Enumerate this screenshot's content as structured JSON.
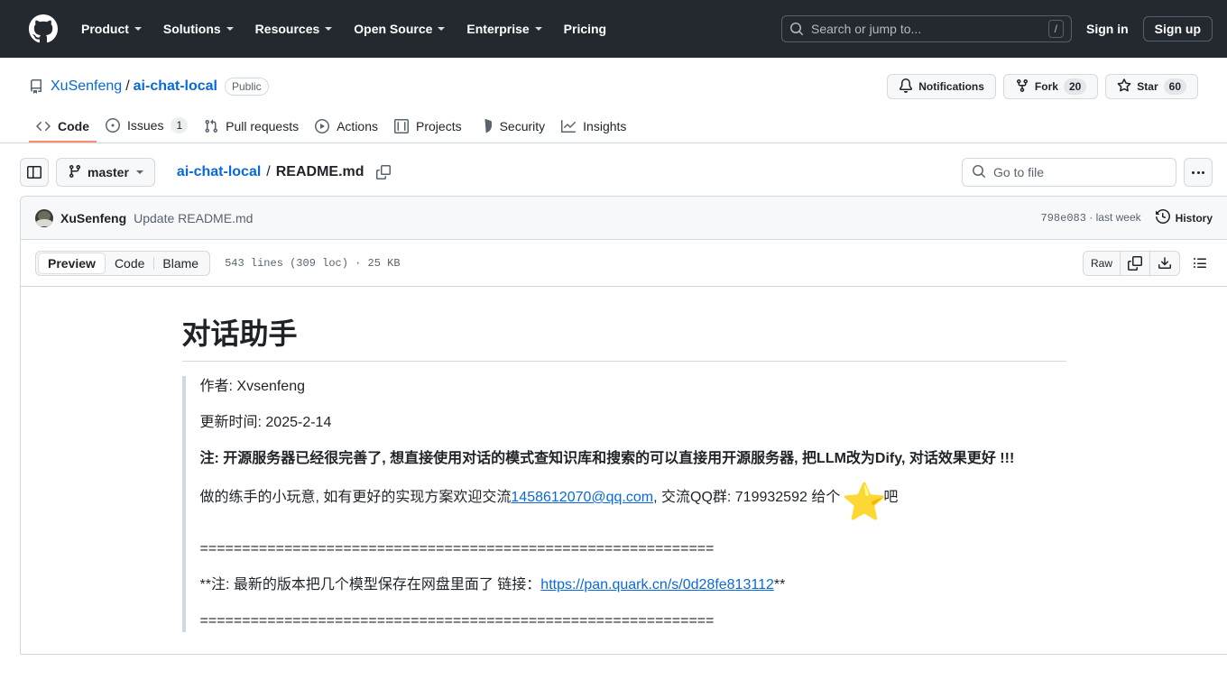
{
  "header": {
    "logo_icon": "github-mark-icon",
    "nav": [
      {
        "label": "Product",
        "has_caret": true
      },
      {
        "label": "Solutions",
        "has_caret": true
      },
      {
        "label": "Resources",
        "has_caret": true
      },
      {
        "label": "Open Source",
        "has_caret": true
      },
      {
        "label": "Enterprise",
        "has_caret": true
      },
      {
        "label": "Pricing",
        "has_caret": false
      }
    ],
    "search": {
      "placeholder": "Search or jump to...",
      "shortcut": "/",
      "icon": "search-icon"
    },
    "sign_in": "Sign in",
    "sign_up": "Sign up"
  },
  "repo": {
    "icon": "repo-book-icon",
    "owner": "XuSenfeng",
    "separator": "/",
    "name": "ai-chat-local",
    "visibility": "Public",
    "actions": {
      "notifications": {
        "label": "Notifications",
        "icon": "bell-icon"
      },
      "fork": {
        "label": "Fork",
        "count": "20",
        "icon": "fork-icon"
      },
      "star": {
        "label": "Star",
        "count": "60",
        "icon": "star-icon"
      }
    },
    "tabs": [
      {
        "label": "Code",
        "icon": "code-icon",
        "active": true,
        "count": ""
      },
      {
        "label": "Issues",
        "icon": "issue-opened-icon",
        "active": false,
        "count": "1"
      },
      {
        "label": "Pull requests",
        "icon": "git-pull-request-icon",
        "active": false,
        "count": ""
      },
      {
        "label": "Actions",
        "icon": "play-icon",
        "active": false,
        "count": ""
      },
      {
        "label": "Projects",
        "icon": "table-icon",
        "active": false,
        "count": ""
      },
      {
        "label": "Security",
        "icon": "shield-icon",
        "active": false,
        "count": ""
      },
      {
        "label": "Insights",
        "icon": "graph-icon",
        "active": false,
        "count": ""
      }
    ]
  },
  "file_nav": {
    "sidebar_toggle_icon": "sidebar-expand-icon",
    "branch": "master",
    "branch_icon": "git-branch-icon",
    "breadcrumb_repo": "ai-chat-local",
    "breadcrumb_sep": "/",
    "breadcrumb_file": "README.md",
    "copy_path_icon": "copy-icon",
    "go_to_file": {
      "placeholder": "Go to file",
      "icon": "search-icon"
    },
    "more_icon": "kebab-horizontal-icon"
  },
  "commit": {
    "avatar": "user-avatar",
    "author": "XuSenfeng",
    "message": "Update README.md",
    "sha": "798e083",
    "dot": " · ",
    "time": "last week",
    "history_label": "History",
    "history_icon": "history-clock-icon"
  },
  "file_toolbar": {
    "views": [
      {
        "label": "Preview",
        "active": true
      },
      {
        "label": "Code",
        "active": false
      },
      {
        "label": "Blame",
        "active": false
      }
    ],
    "meta": "543 lines (309 loc) · 25 KB",
    "raw_label": "Raw",
    "copy_icon": "copy-raw-icon",
    "download_icon": "download-icon",
    "outline_icon": "outline-list-icon"
  },
  "readme": {
    "title": "对话助手",
    "author_line": "作者: Xvsenfeng",
    "updated_line": "更新时间: 2025-2-14",
    "note_bold": "注: 开源服务器已经很完善了, 想直接使用对话的模式查知识库和搜索的可以直接用开源服务器, 把LLM改为Dify, 对话效果更好 !!!",
    "contact_pre": "做的练手的小玩意, 如有更好的实现方案欢迎交流",
    "contact_email": "1458612070@qq.com",
    "contact_mid": ", 交流QQ群: 719932592 给个",
    "star_emoji": "⭐",
    "contact_post": "吧",
    "separator_1": "=============================================================",
    "netdisk_pre": "**注: 最新的版本把几个模型保存在网盘里面了 链接：",
    "netdisk_link": "https://pan.quark.cn/s/0d28fe813112",
    "netdisk_post": "**",
    "separator_2": "============================================================="
  },
  "colors": {
    "header_bg": "#24292f",
    "accent_blue": "#0969da",
    "tab_active_underline": "#fd8c73",
    "border": "#d1d9e0",
    "muted_text": "#59636e"
  }
}
